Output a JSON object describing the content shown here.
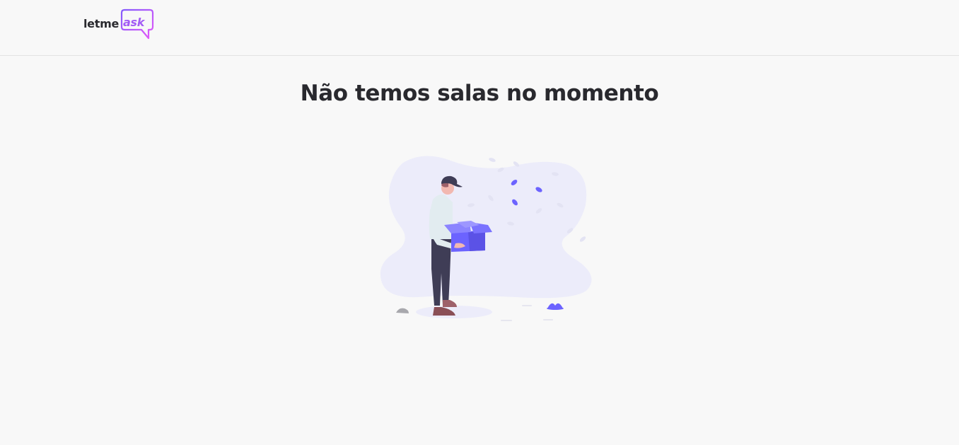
{
  "header": {
    "logo": {
      "left_text": "letme",
      "right_text": "ask"
    }
  },
  "main": {
    "empty_title": "Não temos salas no momento"
  },
  "colors": {
    "accent": "#835afd",
    "logo_gradient_start": "#835afd",
    "logo_gradient_end": "#e559f9",
    "text_dark": "#29292e",
    "background": "#f8f8f8",
    "blob": "#ececfa"
  },
  "icons": {
    "logo": "chat-bubble-logo",
    "illustration": "empty-box-illustration"
  }
}
